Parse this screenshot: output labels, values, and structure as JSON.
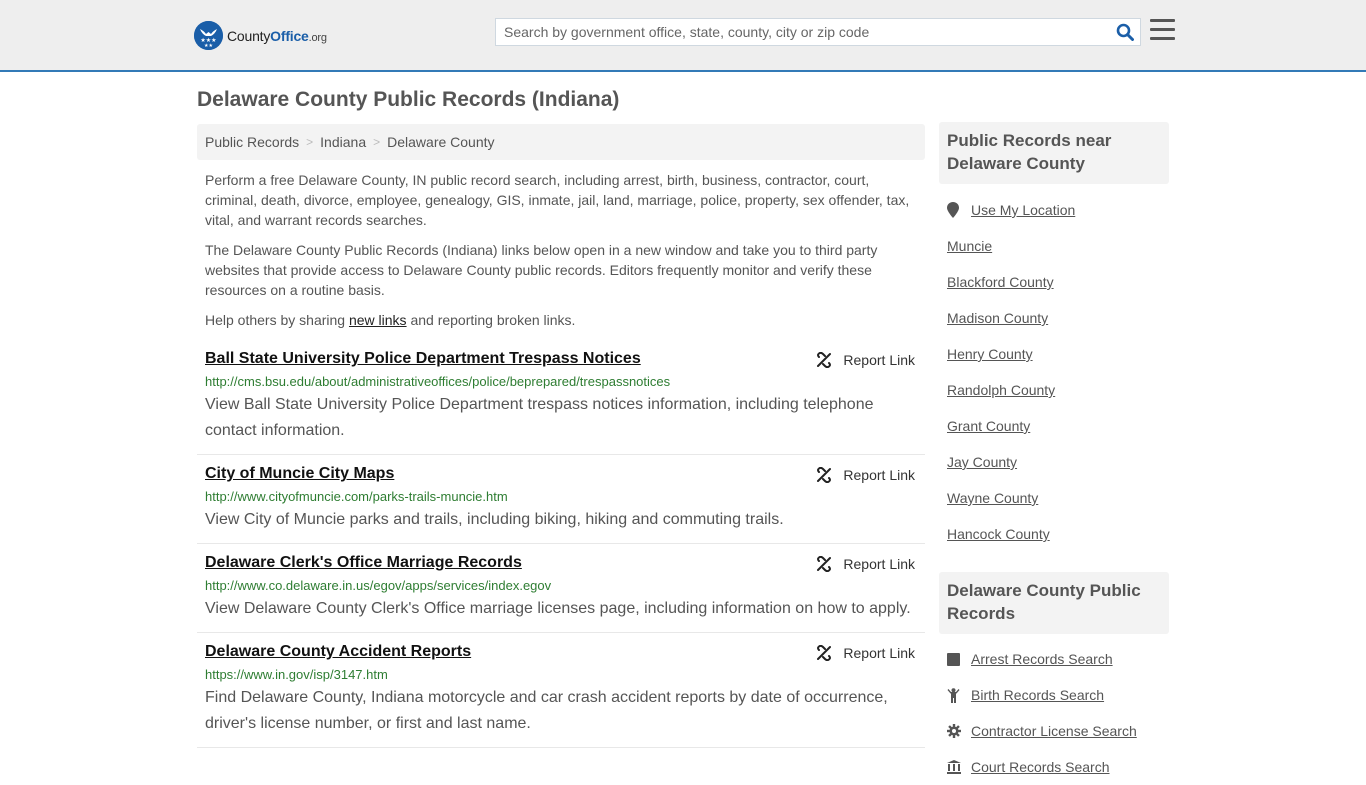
{
  "header": {
    "logo": {
      "part1": "County",
      "part2": "Office",
      "part3": ".org"
    },
    "search": {
      "placeholder": "Search by government office, state, county, city or zip code",
      "value": ""
    },
    "colors": {
      "brand": "#1a5ea8",
      "accent_border": "#337ab7"
    }
  },
  "page_title": "Delaware County Public Records (Indiana)",
  "breadcrumb": [
    {
      "label": "Public Records"
    },
    {
      "label": "Indiana"
    },
    {
      "label": "Delaware County"
    }
  ],
  "intro": {
    "p1": "Perform a free Delaware County, IN public record search, including arrest, birth, business, contractor, court, criminal, death, divorce, employee, genealogy, GIS, inmate, jail, land, marriage, police, property, sex offender, tax, vital, and warrant records searches.",
    "p2": "The Delaware County Public Records (Indiana) links below open in a new window and take you to third party websites that provide access to Delaware County public records. Editors frequently monitor and verify these resources on a routine basis.",
    "p3_before": "Help others by sharing ",
    "p3_link": "new links",
    "p3_after": " and reporting broken links."
  },
  "report_label": "Report Link",
  "links": [
    {
      "title": "Ball State University Police Department Trespass Notices",
      "url": "http://cms.bsu.edu/about/administrativeoffices/police/beprepared/trespassnotices",
      "description": "View Ball State University Police Department trespass notices information, including telephone contact information."
    },
    {
      "title": "City of Muncie City Maps",
      "url": "http://www.cityofmuncie.com/parks-trails-muncie.htm",
      "description": "View City of Muncie parks and trails, including biking, hiking and commuting trails."
    },
    {
      "title": "Delaware Clerk's Office Marriage Records",
      "url": "http://www.co.delaware.in.us/egov/apps/services/index.egov",
      "description": "View Delaware County Clerk's Office marriage licenses page, including information on how to apply."
    },
    {
      "title": "Delaware County Accident Reports",
      "url": "https://www.in.gov/isp/3147.htm",
      "description": "Find Delaware County, Indiana motorcycle and car crash accident reports by date of occurrence, driver's license number, or first and last name."
    }
  ],
  "sidebar": {
    "near_title": "Public Records near Delaware County",
    "use_location": "Use My Location",
    "near_items": [
      "Muncie",
      "Blackford County",
      "Madison County",
      "Henry County",
      "Randolph County",
      "Grant County",
      "Jay County",
      "Wayne County",
      "Hancock County"
    ],
    "records_title": "Delaware County Public Records",
    "records_items": [
      {
        "label": "Arrest Records Search",
        "icon": "square-icon"
      },
      {
        "label": "Birth Records Search",
        "icon": "child-icon"
      },
      {
        "label": "Contractor License Search",
        "icon": "gear-icon"
      },
      {
        "label": "Court Records Search",
        "icon": "courthouse-icon"
      }
    ]
  }
}
